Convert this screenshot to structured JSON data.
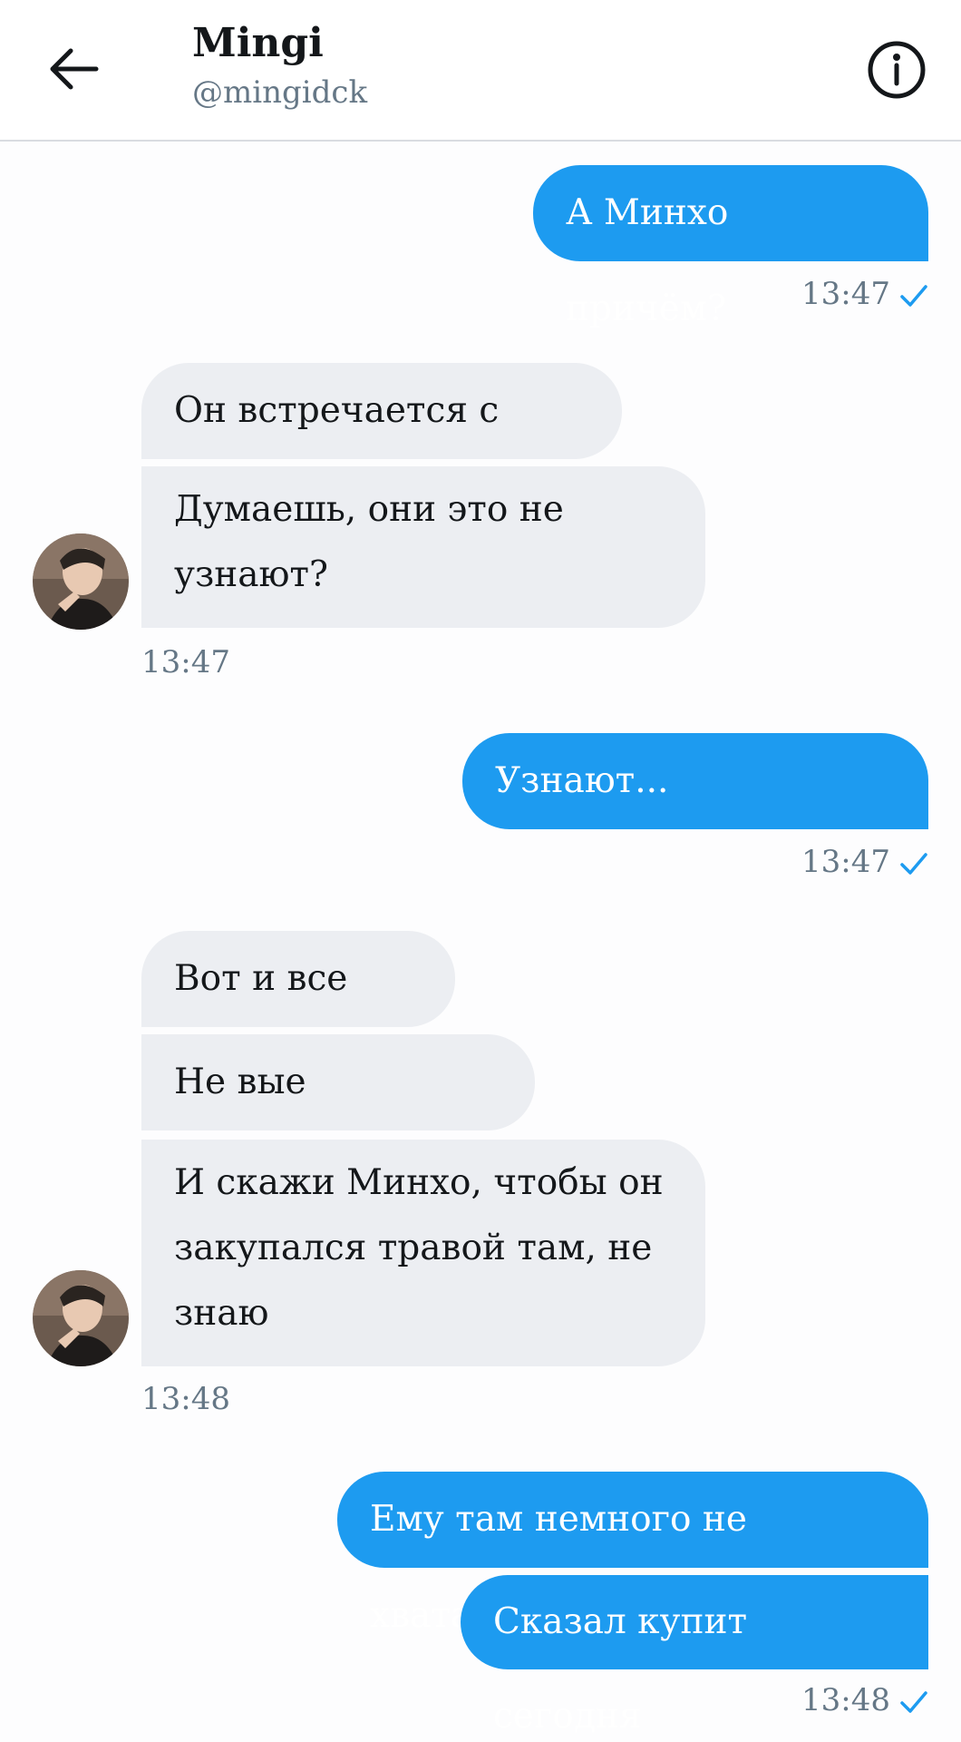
{
  "header": {
    "name": "Mingi",
    "handle": "@mingidck"
  },
  "colors": {
    "accent": "#1d9bf0",
    "incoming_bubble": "#eceef2",
    "meta_text": "#657786"
  },
  "messages": {
    "m1": {
      "text": "А Минхо причём?"
    },
    "t1": {
      "time": "13:47"
    },
    "m2": {
      "text": "Он встречается с псом"
    },
    "m3": {
      "line1": "Думаешь, они это не",
      "line2": "узнают?"
    },
    "t2": {
      "time": "13:47"
    },
    "m4": {
      "text": "Узнают..."
    },
    "t3": {
      "time": "13:47"
    },
    "m5": {
      "text": "Вот и все"
    },
    "m6": {
      "text": "Не вые"
    },
    "m7": {
      "line1": "И скажи Минхо, чтобы он",
      "line2": "закупался травой там, не",
      "line3": "знаю"
    },
    "t4": {
      "time": "13:48"
    },
    "m8": {
      "text": "Ему там немного не хватает"
    },
    "m9": {
      "text": "Сказал купит сегодня"
    },
    "t5": {
      "time": "13:48"
    }
  },
  "icons": {
    "back": "arrow-left-icon",
    "info": "info-icon",
    "read": "checkmark-icon",
    "avatar": "avatar"
  }
}
